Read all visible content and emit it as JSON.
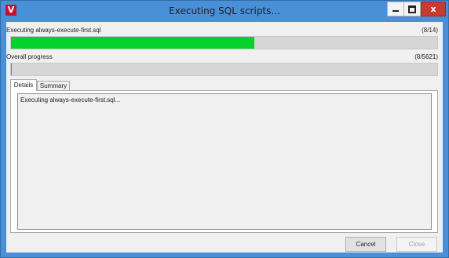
{
  "window": {
    "title": "Executing SQL scripts...",
    "app_icon_letter": "V",
    "close_glyph": "x"
  },
  "current_script": {
    "label": "Executing always-execute-first.sql",
    "count": "(8/14)",
    "progress": 0.5714
  },
  "overall": {
    "label": "Overall progress",
    "count": "(8/5621)",
    "progress": 0.0014
  },
  "tabs": [
    {
      "label": "Details",
      "active": true
    },
    {
      "label": "Summary",
      "active": false
    }
  ],
  "details_log": "Executing always-execute-first.sql...",
  "buttons": {
    "cancel": "Cancel",
    "close": "Close"
  },
  "colors": {
    "progress_fill": "#06d02a",
    "titlebar": "#4a90d9",
    "close_button": "#c83b30",
    "app_icon": "#c8102e"
  }
}
